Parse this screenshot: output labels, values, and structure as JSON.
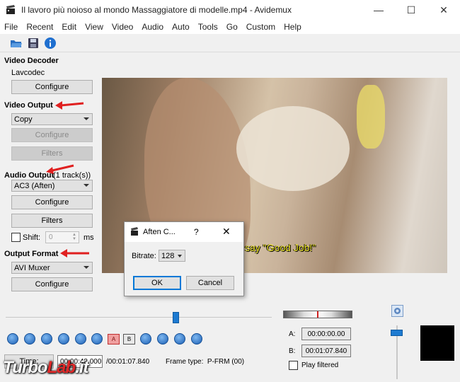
{
  "window": {
    "title": "Il lavoro più noioso al mondo Massaggiatore di modelle.mp4 - Avidemux"
  },
  "menu": [
    "File",
    "Recent",
    "Edit",
    "View",
    "Video",
    "Audio",
    "Auto",
    "Tools",
    "Go",
    "Custom",
    "Help"
  ],
  "video_decoder": {
    "heading": "Video Decoder",
    "codec": "Lavcodec",
    "configure": "Configure"
  },
  "video_output": {
    "heading": "Video Output",
    "selected": "Copy",
    "configure": "Configure",
    "filters": "Filters"
  },
  "audio_output": {
    "heading": "Audio Output",
    "tracks": "(1 track(s))",
    "selected": "AC3 (Aften)",
    "configure": "Configure",
    "filters": "Filters",
    "shift_label": "Shift:",
    "shift_value": "0",
    "shift_unit": "ms"
  },
  "output_format": {
    "heading": "Output Format",
    "selected": "AVI Muxer",
    "configure": "Configure"
  },
  "video": {
    "subtitle": "say \"Good Job!\""
  },
  "dialog": {
    "title": "Aften C...",
    "help": "?",
    "bitrate_label": "Bitrate:",
    "bitrate_value": "128",
    "ok": "OK",
    "cancel": "Cancel"
  },
  "timeline": {
    "position_fraction": 0.64
  },
  "bottom": {
    "time_button": "Time:",
    "current_time": "00:00:43.000",
    "total_time": "/00:01:07.840",
    "frame_type": "Frame type:  P-FRM (00)"
  },
  "markers": {
    "a_label": "A:",
    "a_value": "00:00:00.00",
    "b_label": "B:",
    "b_value": "00:01:07.840",
    "play_filtered": "Play filtered"
  },
  "watermark": {
    "part1": "Turbo",
    "part2": "Lab",
    "part3": ".it"
  },
  "colors": {
    "accent": "#1e7bd1",
    "annotation_arrow": "#e02020",
    "subtitle": "#f3ea2a"
  }
}
